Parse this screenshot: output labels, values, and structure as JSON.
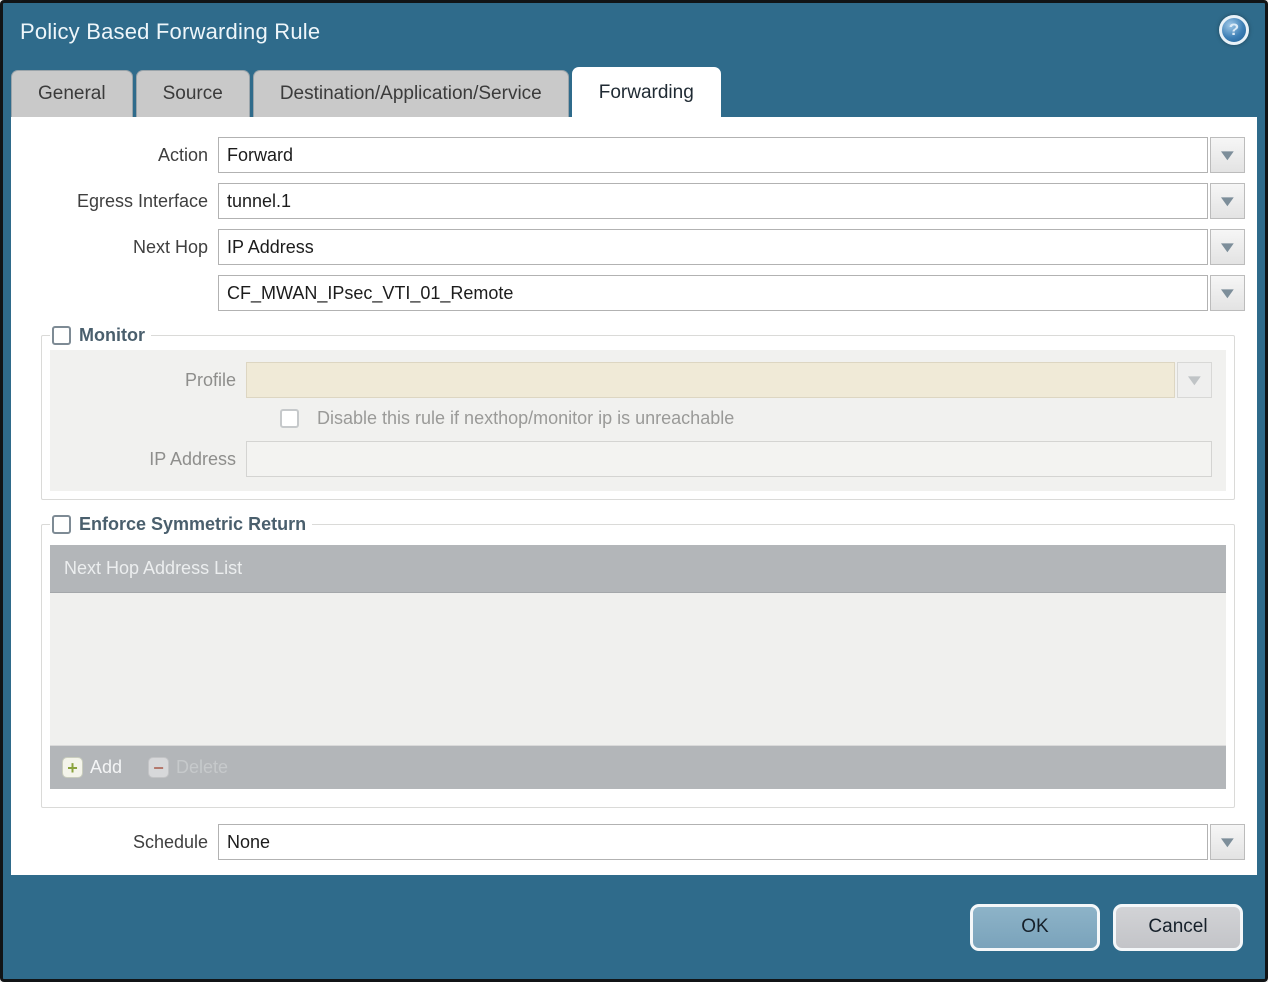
{
  "dialog": {
    "title": "Policy Based Forwarding Rule"
  },
  "icons": {
    "help_glyph": "?",
    "dropdown_glyph": "▼",
    "add_glyph": "+",
    "delete_glyph": "−"
  },
  "tabs": [
    {
      "label": "General",
      "active": false
    },
    {
      "label": "Source",
      "active": false
    },
    {
      "label": "Destination/Application/Service",
      "active": false
    },
    {
      "label": "Forwarding",
      "active": true
    }
  ],
  "form": {
    "action": {
      "label": "Action",
      "value": "Forward"
    },
    "egress_interface": {
      "label": "Egress Interface",
      "value": "tunnel.1"
    },
    "next_hop": {
      "label": "Next Hop",
      "value": "IP Address"
    },
    "next_hop_address": {
      "value": "CF_MWAN_IPsec_VTI_01_Remote"
    },
    "schedule": {
      "label": "Schedule",
      "value": "None"
    }
  },
  "monitor": {
    "legend": "Monitor",
    "checked": false,
    "profile": {
      "label": "Profile",
      "value": ""
    },
    "disable_rule": {
      "label": "Disable this rule if nexthop/monitor ip is unreachable",
      "checked": false
    },
    "ip_address": {
      "label": "IP Address",
      "value": ""
    }
  },
  "symmetric_return": {
    "legend": "Enforce Symmetric Return",
    "checked": false,
    "table": {
      "header": "Next Hop Address List",
      "rows": []
    },
    "add_label": "Add",
    "delete_label": "Delete"
  },
  "footer": {
    "ok_label": "OK",
    "cancel_label": "Cancel"
  },
  "colors": {
    "chrome_teal": "#2f6b8b",
    "active_tab": "#ffffff",
    "inactive_tab": "#c9c9c9",
    "monitor_panel": "#f1f1ef",
    "profile_field_cream": "#f0ead7",
    "table_gray": "#b3b6b9",
    "ok_button": "#7aa3bb",
    "legend_text": "#4a5f6d"
  }
}
